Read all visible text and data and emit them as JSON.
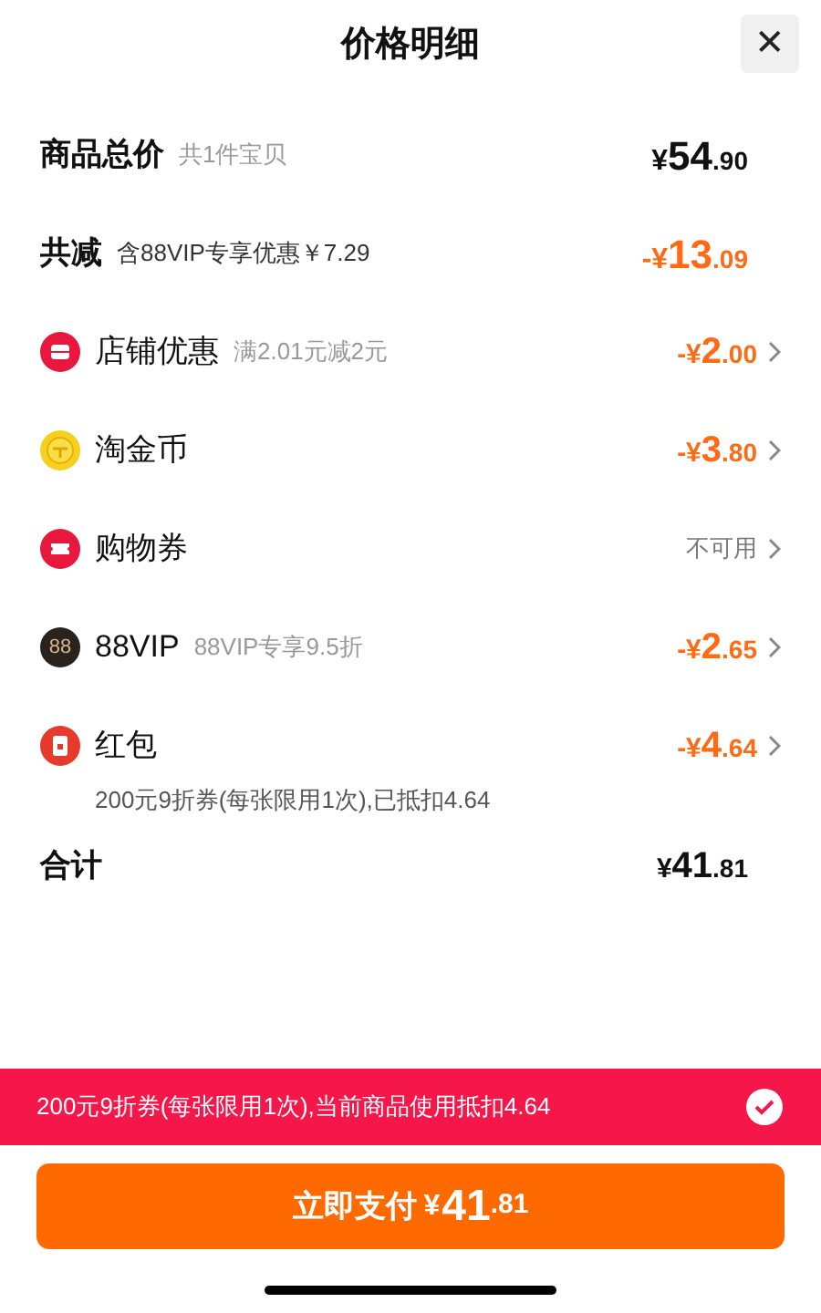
{
  "header": {
    "title": "价格明细",
    "close": "✕"
  },
  "summary": [
    {
      "label": "商品总价",
      "note": "共1件宝贝",
      "amount": {
        "prefix": "¥",
        "integer": "54",
        "decimal": ".90"
      }
    },
    {
      "label": "共减",
      "note": "含88VIP专享优惠￥7.29",
      "amount": {
        "prefix": "-¥",
        "integer": "13",
        "decimal": ".09"
      }
    }
  ],
  "items": [
    {
      "label": "店铺优惠",
      "note": "满2.01元减2元",
      "value": {
        "kind": "amount",
        "prefix": "-¥",
        "integer": "2",
        "decimal": ".00"
      }
    },
    {
      "label": "淘金币",
      "value": {
        "kind": "amount",
        "prefix": "-¥",
        "integer": "3",
        "decimal": ".80"
      }
    },
    {
      "label": "购物券",
      "value": {
        "kind": "text",
        "text": "不可用"
      }
    },
    {
      "badge": "88",
      "label": "88VIP",
      "note": "88VIP专享9.5折",
      "value": {
        "kind": "amount",
        "prefix": "-¥",
        "integer": "2",
        "decimal": ".65"
      }
    },
    {
      "label": "红包",
      "value": {
        "kind": "amount",
        "prefix": "-¥",
        "integer": "4",
        "decimal": ".64"
      },
      "detail": "200元9折券(每张限用1次),已抵扣4.64"
    }
  ],
  "total": {
    "label": "合计",
    "amount": {
      "prefix": "¥",
      "integer": "41",
      "decimal": ".81"
    }
  },
  "banner": {
    "text": "200元9折券(每张限用1次),当前商品使用抵扣4.64",
    "checked": true
  },
  "pay_button": {
    "label": "立即支付",
    "amount": {
      "prefix": "¥",
      "integer": "41",
      "decimal": ".81"
    }
  }
}
